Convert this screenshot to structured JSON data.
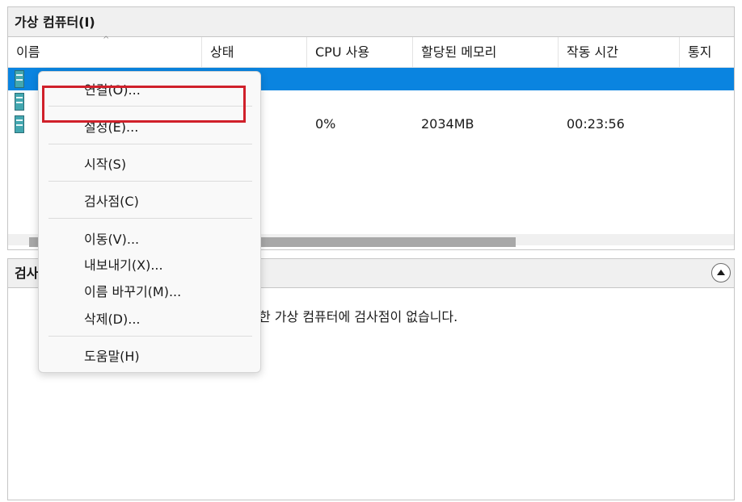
{
  "top_pane": {
    "title": "가상 컴퓨터(I)",
    "columns": [
      "이름",
      "상태",
      "CPU 사용",
      "할당된 메모리",
      "작동 시간",
      "통지"
    ],
    "rows": [
      {
        "name": "",
        "state": "",
        "cpu": "",
        "memory": "",
        "uptime": "",
        "selected": true
      },
      {
        "name": "",
        "state": "",
        "cpu": "",
        "memory": "",
        "uptime": "",
        "selected": false
      },
      {
        "name": "",
        "state": "",
        "cpu": "0%",
        "memory": "2034MB",
        "uptime": "00:23:56",
        "selected": false
      }
    ]
  },
  "bottom_pane": {
    "title": "검사",
    "message": "한 가상 컴퓨터에 검사점이 없습니다."
  },
  "context_menu": {
    "items": [
      {
        "id": "connect",
        "label": "연결(O)..."
      },
      {
        "id": "settings",
        "label": "설정(E)..."
      },
      {
        "id": "start",
        "label": "시작(S)"
      },
      {
        "id": "checkpoint",
        "label": "검사점(C)"
      },
      {
        "id": "move",
        "label": "이동(V)..."
      },
      {
        "id": "export",
        "label": "내보내기(X)..."
      },
      {
        "id": "rename",
        "label": "이름 바꾸기(M)..."
      },
      {
        "id": "delete",
        "label": "삭제(D)..."
      },
      {
        "id": "help",
        "label": "도움말(H)"
      }
    ]
  },
  "colors": {
    "selection": "#0a84e0",
    "highlight_box": "#d0202a"
  },
  "icons": {
    "vm": "vm-icon",
    "collapse": "chevron-up-icon",
    "sort": "sort-caret-icon"
  }
}
